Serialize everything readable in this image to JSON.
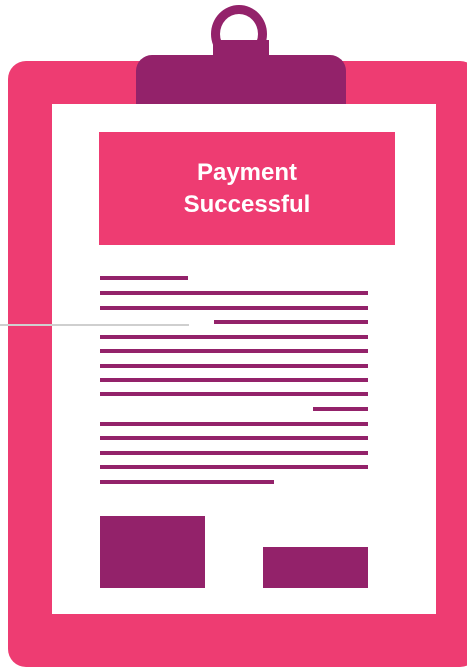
{
  "receipt": {
    "title_line1": "Payment",
    "title_line2": "Successful"
  },
  "colors": {
    "board": "#ee3c72",
    "clip": "#93226a",
    "paper": "#ffffff",
    "text_lines": "#93226a",
    "banner_text": "#ffffff"
  },
  "icons": [
    "clipboard-icon"
  ]
}
